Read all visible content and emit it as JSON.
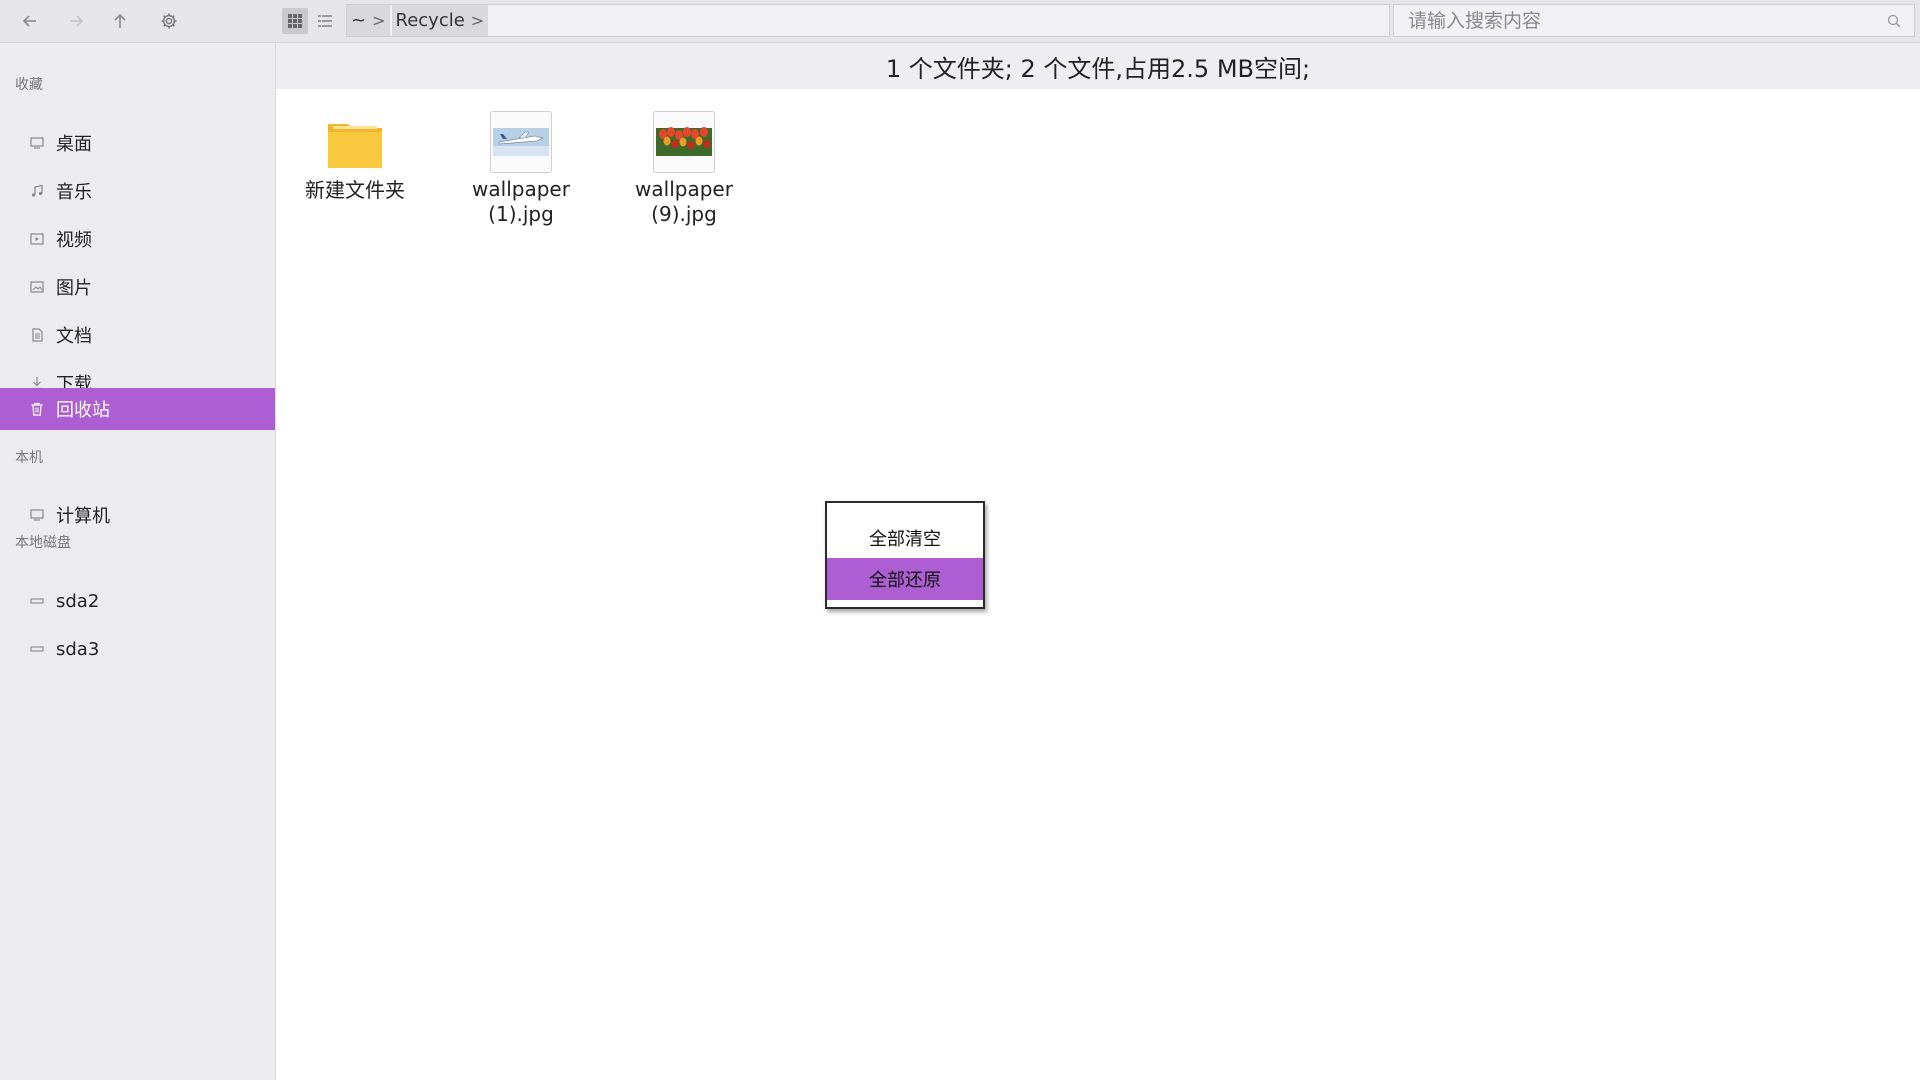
{
  "toolbar": {
    "icons": [
      "arrow-left-icon",
      "arrow-right-icon",
      "arrow-up-icon",
      "gear-icon",
      "grid-view-icon",
      "list-view-icon"
    ],
    "path": [
      {
        "label": "~"
      },
      {
        "label": "Recycle"
      }
    ],
    "search": {
      "placeholder": "请输入搜索内容",
      "value": ""
    }
  },
  "sidebar": {
    "favorites_title": "收藏",
    "favorites": [
      {
        "label": "桌面",
        "icon": "desktop-icon"
      },
      {
        "label": "音乐",
        "icon": "music-icon"
      },
      {
        "label": "视频",
        "icon": "video-icon"
      },
      {
        "label": "图片",
        "icon": "picture-icon"
      },
      {
        "label": "文档",
        "icon": "document-icon"
      },
      {
        "label": "下载",
        "icon": "download-icon"
      },
      {
        "label": "回收站",
        "icon": "trash-icon",
        "selected": true
      }
    ],
    "computer_title": "本机",
    "computer": [
      {
        "label": "计算机",
        "icon": "computer-icon"
      }
    ],
    "disks_title": "本地磁盘",
    "disks": [
      {
        "label": "sda2",
        "icon": "disk-icon"
      },
      {
        "label": "sda3",
        "icon": "disk-icon"
      }
    ]
  },
  "main": {
    "status": "1 个文件夹; 2 个文件,占用2.5 MB空间;",
    "files": [
      {
        "name": "新建文件夹",
        "type": "folder"
      },
      {
        "name_line1": "wallpaper",
        "name_line2": "(1).jpg",
        "type": "image"
      },
      {
        "name_line1": "wallpaper",
        "name_line2": "(9).jpg",
        "type": "image"
      }
    ]
  },
  "context_menu": {
    "items": [
      {
        "label": "全部清空"
      },
      {
        "label": "全部还原",
        "highlighted": true
      }
    ]
  },
  "colors": {
    "accent": "#ac5ed2",
    "folder": "#f7c23a",
    "toolbar_bg": "#e6e6e8",
    "sidebar_bg": "#ececee"
  }
}
